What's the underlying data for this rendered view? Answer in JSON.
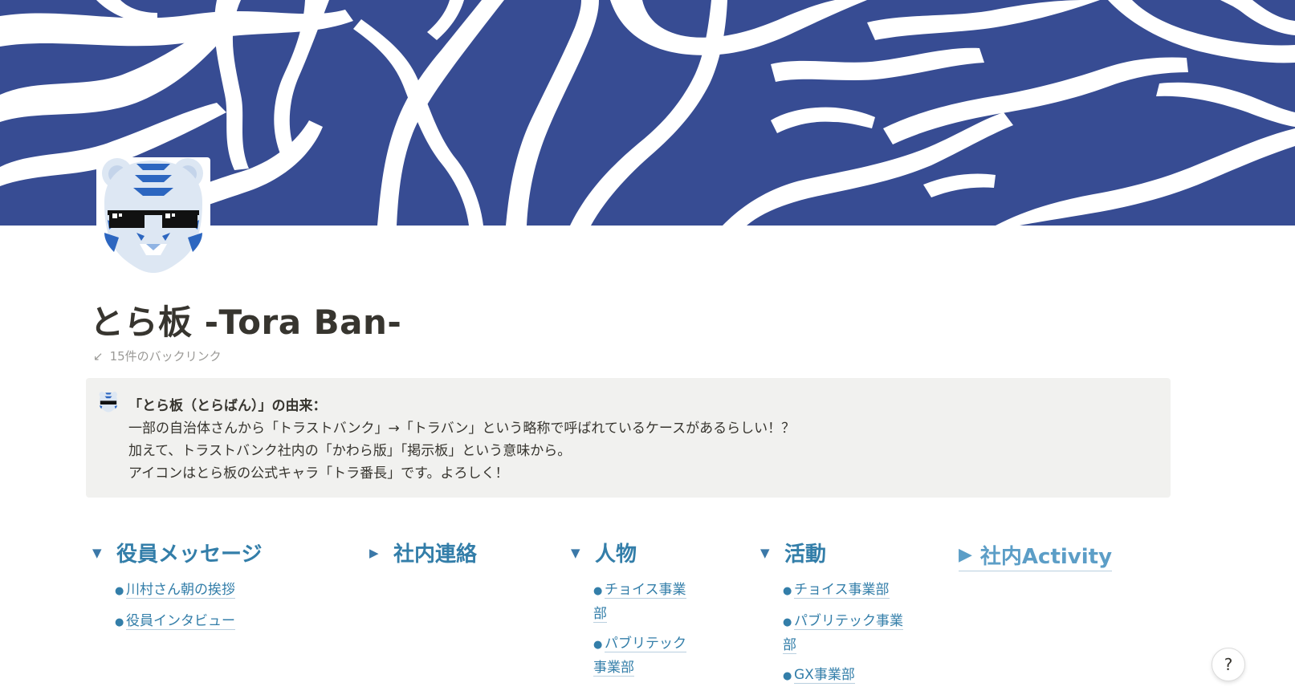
{
  "colors": {
    "cover_blue": "#374c93",
    "link_blue": "#337ea9",
    "activity_blue": "#5c9ec7",
    "callout_bg": "#f1f1ef",
    "text_main": "#37352f",
    "text_muted": "#9b9a97"
  },
  "cover": {
    "icon": "tiger-stripe-cover-image"
  },
  "page_icon": {
    "icon": "tiger-mascot-sunglasses-icon"
  },
  "page": {
    "title": "とら板 -Tora Ban-",
    "backlinks": "15件のバックリンク"
  },
  "callout": {
    "icon": "tiger-mascot-icon",
    "heading": "「とら板（とらばん）」の由来：",
    "lines": [
      "一部の自治体さんから「トラストバンク」→「トラバン」という略称で呼ばれているケースがあるらしい！？",
      "加えて、トラストバンク社内の「かわら版」「掲示板」という意味から。",
      "アイコンはとら板の公式キャラ「トラ番長」です。よろしく！"
    ]
  },
  "columns": [
    {
      "toggle": "▼",
      "title": "役員メッセージ",
      "items": [
        "川村さん朝の挨拶",
        "役員インタビュー"
      ]
    },
    {
      "toggle": "▶",
      "title": "社内連絡",
      "items": []
    },
    {
      "toggle": "▼",
      "title": "人物",
      "items": [
        "チョイス事業部",
        "パブリテック事業部"
      ]
    },
    {
      "toggle": "▼",
      "title": "活動",
      "items": [
        "チョイス事業部",
        "パブリテック事業部",
        "GX事業部"
      ]
    }
  ],
  "activity": {
    "toggle": "▶",
    "label": "社内Activity"
  },
  "help": {
    "label": "?"
  }
}
